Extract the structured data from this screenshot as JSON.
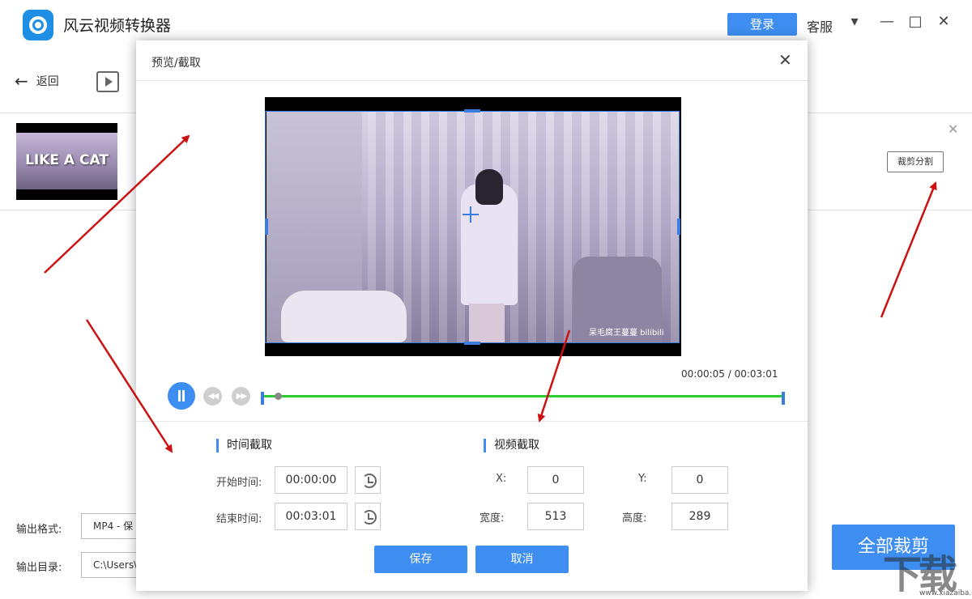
{
  "app": {
    "title": "风云视频转换器"
  },
  "header": {
    "login_label": "登录",
    "service_label": "客服"
  },
  "toolbar": {
    "back_label": "返回"
  },
  "file": {
    "thumb_text": "LIKE A CAT",
    "crop_split_label": "裁剪分割"
  },
  "output": {
    "format_label": "输出格式:",
    "format_value": "MP4 - 保",
    "dir_label": "输出目录:",
    "dir_value": "C:\\Users\\"
  },
  "crop_all_label": "全部裁剪",
  "watermark": {
    "url": "www.xiazaiba.com"
  },
  "dialog": {
    "title": "预览/截取",
    "video_caption": "呆毛腐王蔓蔓  bilibili",
    "time_current": "00:00:05",
    "time_total": "00:03:01",
    "time_readout": "00:00:05 / 00:03:01",
    "progress_fraction": 0.028,
    "time_section": {
      "title": "时间截取",
      "start_label": "开始时间:",
      "start_value": "00:00:00",
      "end_label": "结束时间:",
      "end_value": "00:03:01"
    },
    "video_section": {
      "title": "视频截取",
      "x_label": "X:",
      "x_value": "0",
      "y_label": "Y:",
      "y_value": "0",
      "width_label": "宽度:",
      "width_value": "513",
      "height_label": "高度:",
      "height_value": "289"
    },
    "save_label": "保存",
    "cancel_label": "取消"
  },
  "colors": {
    "accent": "#3d8ef0",
    "progress": "#2ccc32",
    "annotation_arrow": "#cc1111"
  }
}
